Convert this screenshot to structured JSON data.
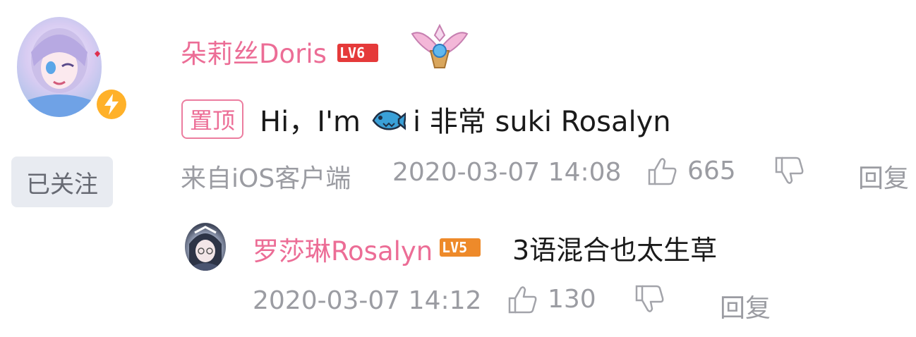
{
  "comment": {
    "username": "朵莉丝Doris",
    "level": "LV6",
    "pin_label": "置顶",
    "text_before_icon": "Hi，I'm",
    "text_after_icon": "i 非常 suki Rosalyn",
    "source": "来自iOS客户端",
    "time": "2020-03-07 14:08",
    "likes": "665",
    "reply_label": "回复",
    "follow_label": "已关注"
  },
  "reply": {
    "username": "罗莎琳Rosalyn",
    "level": "LV5",
    "text": "3语混合也太生草",
    "time": "2020-03-07 14:12",
    "likes": "130",
    "reply_label": "回复"
  },
  "colors": {
    "username": "#ec6d96",
    "lv6": "#e53a3a",
    "lv5": "#ee8a2a",
    "meta": "#9b9ca2",
    "verify": "#ffb129"
  },
  "icons": [
    "lightning-icon",
    "wing-badge-icon",
    "fish-emoji-icon",
    "thumbs-up-icon",
    "thumbs-down-icon"
  ]
}
